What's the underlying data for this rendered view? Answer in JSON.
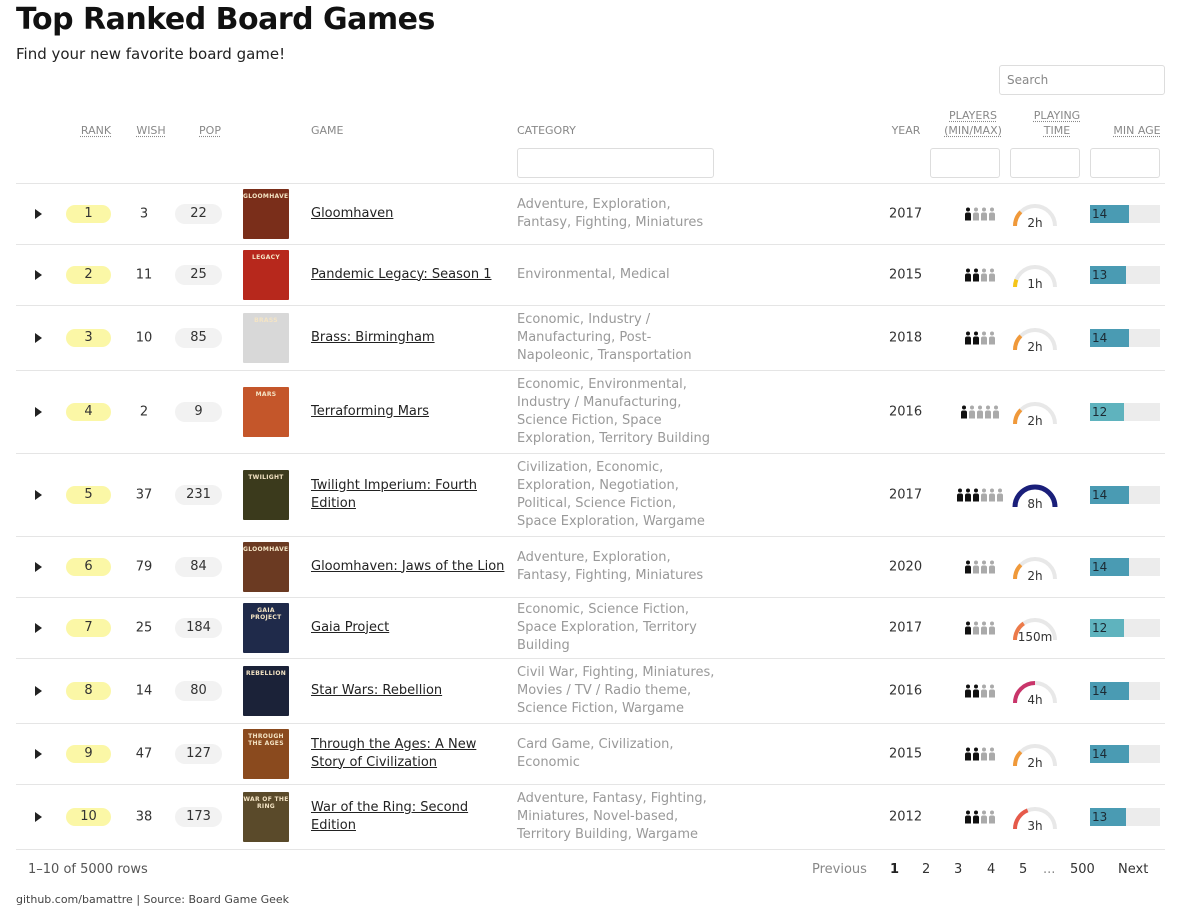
{
  "page": {
    "title": "Top Ranked Board Games",
    "subtitle": "Find your new favorite board game!",
    "search_placeholder": "Search"
  },
  "columns": {
    "rank": "RANK",
    "wish": "WISH",
    "pop": "POP",
    "game": "GAME",
    "category": "CATEGORY",
    "year": "YEAR",
    "players_line1": "PLAYERS",
    "players_line2": "(MIN/MAX)",
    "time_line1": "PLAYING",
    "time_line2": "TIME",
    "min_age": "MIN AGE"
  },
  "colors": {
    "rank_badge": "#fbf7a6",
    "pop_badge": "#f2f2f2",
    "gauge_track": "#e8e8e8",
    "age_track": "#ececec"
  },
  "rows": [
    {
      "rank": "1",
      "wish": "3",
      "pop": "22",
      "thumb_label": "GLOOMHAVEN",
      "thumb_color": "#7a2e1a",
      "game": "Gloomhaven",
      "category": "Adventure, Exploration, Fantasy, Fighting, Miniatures",
      "year": "2017",
      "players_min": 1,
      "players_max": 4,
      "time": "2h",
      "time_fill": 0.25,
      "time_color": "#f0993a",
      "age": "14",
      "age_fill": 0.56,
      "age_color": "#4a9bb3"
    },
    {
      "rank": "2",
      "wish": "11",
      "pop": "25",
      "thumb_label": "LEGACY",
      "thumb_color": "#b7281c",
      "game": "Pandemic Legacy: Season 1",
      "category": "Environmental, Medical",
      "year": "2015",
      "players_min": 2,
      "players_max": 4,
      "time": "1h",
      "time_fill": 0.12,
      "time_color": "#f5c518",
      "age": "13",
      "age_fill": 0.52,
      "age_color": "#4a9bb3"
    },
    {
      "rank": "3",
      "wish": "10",
      "pop": "85",
      "thumb_label": "BRASS",
      "thumb_color": "#d8d8d8",
      "game": "Brass: Birmingham",
      "category": "Economic, Industry / Manufacturing, Post-Napoleonic, Transportation",
      "year": "2018",
      "players_min": 2,
      "players_max": 4,
      "time": "2h",
      "time_fill": 0.25,
      "time_color": "#f0993a",
      "age": "14",
      "age_fill": 0.56,
      "age_color": "#4a9bb3"
    },
    {
      "rank": "4",
      "wish": "2",
      "pop": "9",
      "thumb_label": "MARS",
      "thumb_color": "#c4562a",
      "game": "Terraforming Mars",
      "category": "Economic, Environmental, Industry / Manufacturing, Science Fiction, Space Exploration, Territory Building",
      "year": "2016",
      "players_min": 1,
      "players_max": 5,
      "time": "2h",
      "time_fill": 0.25,
      "time_color": "#f0993a",
      "age": "12",
      "age_fill": 0.48,
      "age_color": "#5fb3be"
    },
    {
      "rank": "5",
      "wish": "37",
      "pop": "231",
      "thumb_label": "TWILIGHT",
      "thumb_color": "#3b3a1c",
      "game": "Twilight Imperium: Fourth Edition",
      "category": "Civilization, Economic, Exploration, Negotiation, Political, Science Fiction, Space Exploration, Wargame",
      "year": "2017",
      "players_min": 3,
      "players_max": 6,
      "time": "8h",
      "time_fill": 1.0,
      "time_color": "#1a1f7a",
      "age": "14",
      "age_fill": 0.56,
      "age_color": "#4a9bb3"
    },
    {
      "rank": "6",
      "wish": "79",
      "pop": "84",
      "thumb_label": "GLOOMHAVEN",
      "thumb_color": "#6b3a22",
      "game": "Gloomhaven: Jaws of the Lion",
      "category": "Adventure, Exploration, Fantasy, Fighting, Miniatures",
      "year": "2020",
      "players_min": 1,
      "players_max": 4,
      "time": "2h",
      "time_fill": 0.25,
      "time_color": "#f0993a",
      "age": "14",
      "age_fill": 0.56,
      "age_color": "#4a9bb3"
    },
    {
      "rank": "7",
      "wish": "25",
      "pop": "184",
      "thumb_label": "GAIA PROJECT",
      "thumb_color": "#1f2a4a",
      "game": "Gaia Project",
      "category": "Economic, Science Fiction, Space Exploration, Territory Building",
      "year": "2017",
      "players_min": 1,
      "players_max": 4,
      "time": "150m",
      "time_fill": 0.31,
      "time_color": "#ec7a4a",
      "age": "12",
      "age_fill": 0.48,
      "age_color": "#5fb3be"
    },
    {
      "rank": "8",
      "wish": "14",
      "pop": "80",
      "thumb_label": "REBELLION",
      "thumb_color": "#1b2238",
      "game": "Star Wars: Rebellion",
      "category": "Civil War, Fighting, Miniatures, Movies / TV / Radio theme, Science Fiction, Wargame",
      "year": "2016",
      "players_min": 2,
      "players_max": 4,
      "time": "4h",
      "time_fill": 0.5,
      "time_color": "#c9356a",
      "age": "14",
      "age_fill": 0.56,
      "age_color": "#4a9bb3"
    },
    {
      "rank": "9",
      "wish": "47",
      "pop": "127",
      "thumb_label": "THROUGH THE AGES",
      "thumb_color": "#8a4a1e",
      "game": "Through the Ages: A New Story of Civilization",
      "category": "Card Game, Civilization, Economic",
      "year": "2015",
      "players_min": 2,
      "players_max": 4,
      "time": "2h",
      "time_fill": 0.25,
      "time_color": "#f0993a",
      "age": "14",
      "age_fill": 0.56,
      "age_color": "#4a9bb3"
    },
    {
      "rank": "10",
      "wish": "38",
      "pop": "173",
      "thumb_label": "WAR OF THE RING",
      "thumb_color": "#5a4a2a",
      "game": "War of the Ring: Second Edition",
      "category": "Adventure, Fantasy, Fighting, Miniatures, Novel-based, Territory Building, Wargame",
      "year": "2012",
      "players_min": 2,
      "players_max": 4,
      "time": "3h",
      "time_fill": 0.38,
      "time_color": "#e65a4a",
      "age": "13",
      "age_fill": 0.52,
      "age_color": "#4a9bb3"
    }
  ],
  "pagination": {
    "info": "1–10 of 5000 rows",
    "previous": "Previous",
    "pages": [
      "1",
      "2",
      "3",
      "4",
      "5",
      "...",
      "500"
    ],
    "next": "Next",
    "current": "1"
  },
  "credit": "github.com/bamattre | Source: Board Game Geek"
}
